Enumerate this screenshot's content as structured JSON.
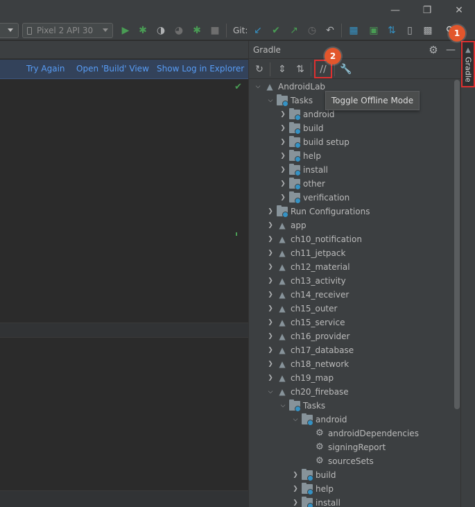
{
  "toolbar": {
    "device_label": "Pixel 2 API 30",
    "git_label": "Git:"
  },
  "notification": {
    "try_again": "Try Again",
    "open_build": "Open 'Build' View",
    "show_log": "Show Log in Explorer"
  },
  "gradle": {
    "panel_title": "Gradle",
    "tab_label": "Gradle",
    "tooltip": "Toggle Offline Mode",
    "tree": [
      {
        "label": "AndroidLab",
        "depth": 0,
        "icon": "elephant",
        "chev": "down"
      },
      {
        "label": "Tasks",
        "depth": 1,
        "icon": "folder",
        "chev": "down"
      },
      {
        "label": "android",
        "depth": 2,
        "icon": "folder",
        "chev": "right"
      },
      {
        "label": "build",
        "depth": 2,
        "icon": "folder",
        "chev": "right"
      },
      {
        "label": "build setup",
        "depth": 2,
        "icon": "folder",
        "chev": "right"
      },
      {
        "label": "help",
        "depth": 2,
        "icon": "folder",
        "chev": "right"
      },
      {
        "label": "install",
        "depth": 2,
        "icon": "folder",
        "chev": "right"
      },
      {
        "label": "other",
        "depth": 2,
        "icon": "folder",
        "chev": "right"
      },
      {
        "label": "verification",
        "depth": 2,
        "icon": "folder",
        "chev": "right"
      },
      {
        "label": "Run Configurations",
        "depth": 1,
        "icon": "folder",
        "chev": "right"
      },
      {
        "label": "app",
        "depth": 1,
        "icon": "elephant",
        "chev": "right"
      },
      {
        "label": "ch10_notification",
        "depth": 1,
        "icon": "elephant",
        "chev": "right"
      },
      {
        "label": "ch11_jetpack",
        "depth": 1,
        "icon": "elephant",
        "chev": "right"
      },
      {
        "label": "ch12_material",
        "depth": 1,
        "icon": "elephant",
        "chev": "right"
      },
      {
        "label": "ch13_activity",
        "depth": 1,
        "icon": "elephant",
        "chev": "right"
      },
      {
        "label": "ch14_receiver",
        "depth": 1,
        "icon": "elephant",
        "chev": "right"
      },
      {
        "label": "ch15_outer",
        "depth": 1,
        "icon": "elephant",
        "chev": "right"
      },
      {
        "label": "ch15_service",
        "depth": 1,
        "icon": "elephant",
        "chev": "right"
      },
      {
        "label": "ch16_provider",
        "depth": 1,
        "icon": "elephant",
        "chev": "right"
      },
      {
        "label": "ch17_database",
        "depth": 1,
        "icon": "elephant",
        "chev": "right"
      },
      {
        "label": "ch18_network",
        "depth": 1,
        "icon": "elephant",
        "chev": "right"
      },
      {
        "label": "ch19_map",
        "depth": 1,
        "icon": "elephant",
        "chev": "right"
      },
      {
        "label": "ch20_firebase",
        "depth": 1,
        "icon": "elephant",
        "chev": "down"
      },
      {
        "label": "Tasks",
        "depth": 2,
        "icon": "folder",
        "chev": "down"
      },
      {
        "label": "android",
        "depth": 3,
        "icon": "folder",
        "chev": "down"
      },
      {
        "label": "androidDependencies",
        "depth": 4,
        "icon": "gear",
        "chev": "none"
      },
      {
        "label": "signingReport",
        "depth": 4,
        "icon": "gear",
        "chev": "none"
      },
      {
        "label": "sourceSets",
        "depth": 4,
        "icon": "gear",
        "chev": "none"
      },
      {
        "label": "build",
        "depth": 3,
        "icon": "folder",
        "chev": "right"
      },
      {
        "label": "help",
        "depth": 3,
        "icon": "folder",
        "chev": "right"
      },
      {
        "label": "install",
        "depth": 3,
        "icon": "folder",
        "chev": "right"
      }
    ]
  },
  "callouts": {
    "one": "1",
    "two": "2"
  },
  "colors": {
    "accent_link": "#589df6",
    "success": "#499c54",
    "highlight": "#e03030",
    "callout": "#e2562c"
  }
}
